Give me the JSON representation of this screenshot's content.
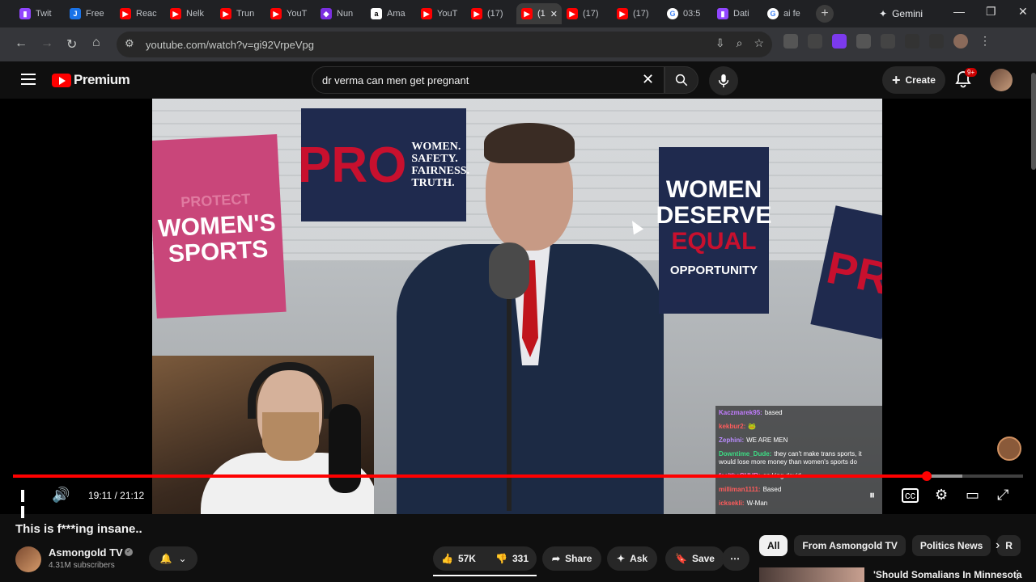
{
  "browser": {
    "tabs": [
      {
        "label": "Twit",
        "icon": "twitch-icon"
      },
      {
        "label": "Free",
        "icon": "j-icon"
      },
      {
        "label": "Reac",
        "icon": "youtube-icon"
      },
      {
        "label": "Nelk",
        "icon": "youtube-icon"
      },
      {
        "label": "Trun",
        "icon": "youtube-icon"
      },
      {
        "label": "YouT",
        "icon": "youtube-icon"
      },
      {
        "label": "Nun",
        "icon": "app-icon"
      },
      {
        "label": "Ama",
        "icon": "amazon-icon"
      },
      {
        "label": "YouT",
        "icon": "youtube-icon"
      },
      {
        "label": "(17)",
        "icon": "youtube-icon"
      },
      {
        "label": "(1",
        "icon": "speaker-icon",
        "active": true
      },
      {
        "label": "(17)",
        "icon": "youtube-icon"
      },
      {
        "label": "(17)",
        "icon": "youtube-icon"
      },
      {
        "label": "03:5",
        "icon": "google-icon"
      },
      {
        "label": "Dati",
        "icon": "twitch-icon"
      },
      {
        "label": "ai fe",
        "icon": "google-icon"
      }
    ],
    "gemini_label": "Gemini",
    "url": "youtube.com/watch?v=gi92VrpeVpg"
  },
  "youtube": {
    "logo_text": "Premium",
    "search_query": "dr verma can men get pregnant",
    "create_label": "Create",
    "notifications_badge": "9+"
  },
  "video": {
    "signs": {
      "pink_top": "PROTECT",
      "pink_main": "WOMEN'S SPORTS",
      "navy_pro": "PRO",
      "navy_lines": [
        "WOMEN.",
        "SAFETY.",
        "FAIRNESS.",
        "TRUTH."
      ],
      "navy2_main": "WOMEN DESERVE",
      "navy2_equal": "EQUAL",
      "navy2_opportunity": "OPPORTUNITY",
      "navy3": "PR"
    },
    "chat": [
      {
        "user": "Kaczmarek95:",
        "text": "based",
        "color": "#c27cff"
      },
      {
        "user": "kekbur2:",
        "text": "🐸",
        "color": "#ff5c5c"
      },
      {
        "user": "Zephini:",
        "text": "WE ARE MEN",
        "color": "#b98cff"
      },
      {
        "user": "Downtime_Dude:",
        "text": "they can't make trans sports, it would lose more money than women's sports do",
        "color": "#3ddc84"
      },
      {
        "user": "feeltheCHUB:",
        "text": "on king david",
        "color": "#ff7ad9"
      },
      {
        "user": "milliman1111:",
        "text": "Based",
        "color": "#ff5c5c"
      },
      {
        "user": "icksekli:",
        "text": "W-Man",
        "color": "#ff5c5c"
      }
    ],
    "current_time": "19:11",
    "duration": "21:12",
    "time_display": "19:11 / 21:12",
    "played_fraction": 0.905,
    "loaded_fraction": 0.94
  },
  "meta": {
    "title": "This is f***ing insane..",
    "channel_name": "Asmongold TV",
    "subscribers": "4.31M subscribers",
    "likes": "57K",
    "dislikes": "331",
    "share_label": "Share",
    "ask_label": "Ask",
    "save_label": "Save"
  },
  "chips": [
    "All",
    "From Asmongold TV",
    "Politics News",
    "R"
  ],
  "recommendation": {
    "title": "'Should Somalians In Minnesota"
  }
}
